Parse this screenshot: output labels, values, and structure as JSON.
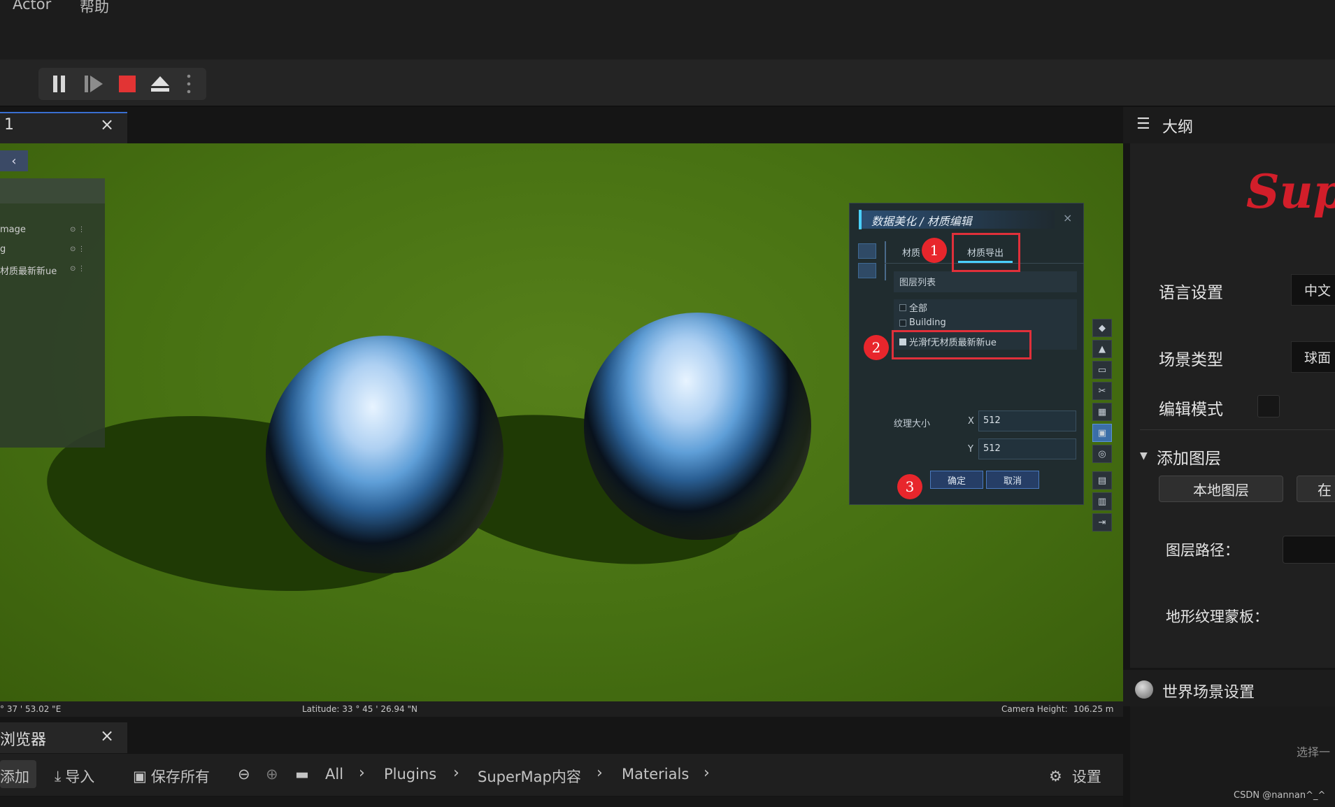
{
  "menubar": {
    "items": [
      "Actor",
      "帮助"
    ]
  },
  "toolbar": {
    "buttons": [
      "pause-icon",
      "step-icon",
      "stop-icon",
      "eject-icon",
      "more-icon"
    ],
    "stop_color": "#e23434"
  },
  "viewport_tab": {
    "label": "1",
    "close": "×"
  },
  "side_panel": {
    "rows": [
      "mage",
      "g",
      "材质最新新ue"
    ]
  },
  "dialog": {
    "title": "数据美化 / 材质编辑",
    "close": "×",
    "tabs": [
      "材质",
      "材质导出"
    ],
    "list_header": "图层列表",
    "list_items": [
      {
        "label": "全部",
        "checked": false
      },
      {
        "label": "Building",
        "checked": false
      },
      {
        "label": "光滑f无材质最新新ue",
        "checked": true
      }
    ],
    "texture_label": "纹理大小",
    "x_label": "X",
    "x_value": "512",
    "y_label": "Y",
    "y_value": "512",
    "ok": "确定",
    "cancel": "取消"
  },
  "markers": [
    "1",
    "2",
    "3"
  ],
  "statusbar": {
    "longitude": "° 37 ' 53.02 \"E",
    "latitude": "Latitude:  33 ° 45 ' 26.94 \"N",
    "camera_label": "Camera Height:",
    "camera_value": "106.25 m"
  },
  "bottom_tab": {
    "label": "浏览器",
    "close": "×"
  },
  "content_browser": {
    "add": "添加",
    "import": "导入",
    "save_all": "保存所有",
    "path": [
      "All",
      "Plugins",
      "SuperMap内容",
      "Materials"
    ],
    "settings": "设置"
  },
  "outline": {
    "title": "大纲"
  },
  "right_panel": {
    "logo": "Supe",
    "language_label": "语言设置",
    "language_value": "中文",
    "scene_label": "场景类型",
    "scene_value": "球面",
    "edit_label": "编辑模式",
    "add_layer": "添加图层",
    "local_layer": "本地图层",
    "other_layer": "在",
    "layer_path": "图层路径：",
    "terrain_mask": "地形纹理蒙板："
  },
  "world": {
    "title": "世界场景设置",
    "select": "选择一"
  },
  "watermark": "CSDN @nannan^_^"
}
